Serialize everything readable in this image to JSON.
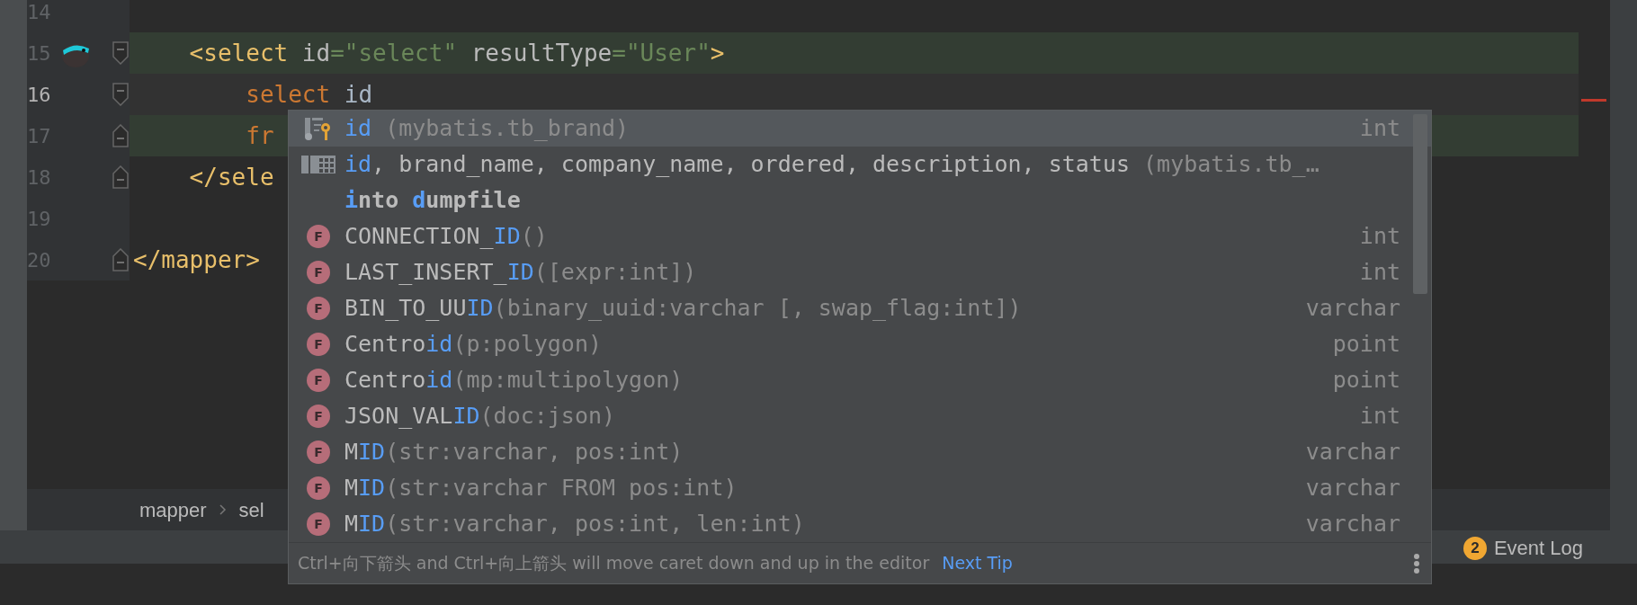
{
  "editor": {
    "lines": [
      {
        "number": "14",
        "kind": "plain",
        "current": false,
        "highlighted": false,
        "gutter_icon": false
      },
      {
        "number": "15",
        "kind": "fold_start",
        "current": false,
        "highlighted": true,
        "gutter_icon": true,
        "parts": [
          {
            "text": "    <select",
            "kind": "tag"
          },
          {
            "text": " id",
            "kind": "attr"
          },
          {
            "text": "=\"select\"",
            "kind": "value"
          },
          {
            "text": " resultType",
            "kind": "attr"
          },
          {
            "text": "=\"User\"",
            "kind": "value"
          },
          {
            "text": ">",
            "kind": "tag"
          }
        ]
      },
      {
        "number": "16",
        "kind": "fold_start",
        "current": true,
        "highlighted": false,
        "gutter_icon": false,
        "parts": [
          {
            "text": "        select",
            "kind": "keyword"
          },
          {
            "text": " id",
            "kind": "plain"
          }
        ]
      },
      {
        "number": "17",
        "kind": "fold_end",
        "current": false,
        "highlighted": true,
        "gutter_icon": false,
        "parts": [
          {
            "text": "        fr",
            "kind": "keyword"
          }
        ]
      },
      {
        "number": "18",
        "kind": "fold_end",
        "current": false,
        "highlighted": false,
        "gutter_icon": false,
        "parts": [
          {
            "text": "    </sele",
            "kind": "tag"
          }
        ]
      },
      {
        "number": "19",
        "kind": "plain",
        "current": false,
        "highlighted": false,
        "gutter_icon": false
      },
      {
        "number": "20",
        "kind": "fold_end",
        "current": false,
        "highlighted": false,
        "gutter_icon": false,
        "parts": [
          {
            "text": "</mapper>",
            "kind": "tag"
          }
        ]
      }
    ]
  },
  "completion": {
    "items": [
      {
        "kind": "column",
        "selected": true,
        "parts": [
          {
            "text": "id",
            "kind": "match"
          },
          {
            "text": " (mybatis.tb_brand)",
            "kind": "detail"
          }
        ],
        "type": "int"
      },
      {
        "kind": "table",
        "selected": false,
        "parts": [
          {
            "text": "id",
            "kind": "match"
          },
          {
            "text": ", brand_name, company_name, ordered, description, status",
            "kind": "name"
          },
          {
            "text": " (mybatis.tb_…",
            "kind": "detail"
          }
        ]
      },
      {
        "kind": "keyword",
        "selected": false,
        "parts": [
          {
            "text": "i",
            "kind": "match"
          },
          {
            "text": "nto ",
            "kind": "name"
          },
          {
            "text": "d",
            "kind": "match"
          },
          {
            "text": "umpfile",
            "kind": "name"
          }
        ]
      },
      {
        "kind": "function",
        "badge": "F",
        "selected": false,
        "parts": [
          {
            "text": "CONNECTION_",
            "kind": "name"
          },
          {
            "text": "ID",
            "kind": "match"
          },
          {
            "text": "()",
            "kind": "detail"
          }
        ],
        "type": "int"
      },
      {
        "kind": "function",
        "badge": "F",
        "selected": false,
        "parts": [
          {
            "text": "LAST_INSERT_",
            "kind": "name"
          },
          {
            "text": "ID",
            "kind": "match"
          },
          {
            "text": "([expr:int])",
            "kind": "detail"
          }
        ],
        "type": "int"
      },
      {
        "kind": "function",
        "badge": "F",
        "selected": false,
        "parts": [
          {
            "text": "BIN_TO_UU",
            "kind": "name"
          },
          {
            "text": "ID",
            "kind": "match"
          },
          {
            "text": "(binary_uuid:varchar [, swap_flag:int])",
            "kind": "detail"
          }
        ],
        "type": "varchar"
      },
      {
        "kind": "function",
        "badge": "F",
        "selected": false,
        "parts": [
          {
            "text": "Centro",
            "kind": "name"
          },
          {
            "text": "id",
            "kind": "match"
          },
          {
            "text": "(p:polygon)",
            "kind": "detail"
          }
        ],
        "type": "point"
      },
      {
        "kind": "function",
        "badge": "F",
        "selected": false,
        "parts": [
          {
            "text": "Centro",
            "kind": "name"
          },
          {
            "text": "id",
            "kind": "match"
          },
          {
            "text": "(mp:multipolygon)",
            "kind": "detail"
          }
        ],
        "type": "point"
      },
      {
        "kind": "function",
        "badge": "F",
        "selected": false,
        "parts": [
          {
            "text": "JSON_VAL",
            "kind": "name"
          },
          {
            "text": "ID",
            "kind": "match"
          },
          {
            "text": "(doc:json)",
            "kind": "detail"
          }
        ],
        "type": "int"
      },
      {
        "kind": "function",
        "badge": "F",
        "selected": false,
        "parts": [
          {
            "text": "M",
            "kind": "name"
          },
          {
            "text": "ID",
            "kind": "match"
          },
          {
            "text": "(str:varchar, pos:int)",
            "kind": "detail"
          }
        ],
        "type": "varchar"
      },
      {
        "kind": "function",
        "badge": "F",
        "selected": false,
        "parts": [
          {
            "text": "M",
            "kind": "name"
          },
          {
            "text": "ID",
            "kind": "match"
          },
          {
            "text": "(str:varchar FROM pos:int)",
            "kind": "detail"
          }
        ],
        "type": "varchar"
      },
      {
        "kind": "function",
        "badge": "F",
        "selected": false,
        "parts": [
          {
            "text": "M",
            "kind": "name"
          },
          {
            "text": "ID",
            "kind": "match"
          },
          {
            "text": "(str:varchar, pos:int, len:int)",
            "kind": "detail"
          }
        ],
        "type": "varchar"
      }
    ],
    "tip": "Ctrl+向下箭头 and Ctrl+向上箭头 will move caret down and up in the editor",
    "tip_link": "Next Tip"
  },
  "breadcrumb": [
    "mapper",
    "sel"
  ],
  "status_bar": {
    "event_count": "2",
    "event_label": "Event Log"
  }
}
